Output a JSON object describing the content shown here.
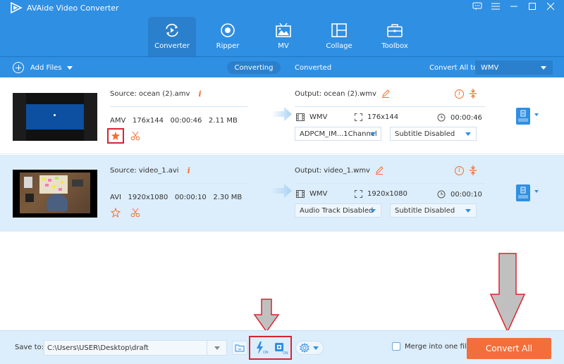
{
  "app": {
    "title": "AVAide Video Converter",
    "window_controls": [
      "feedback-icon",
      "menu-icon",
      "minimize-icon",
      "maximize-icon",
      "close-icon"
    ]
  },
  "nav": {
    "items": [
      {
        "label": "Converter",
        "icon": "converter-icon",
        "active": true
      },
      {
        "label": "Ripper",
        "icon": "ripper-icon",
        "active": false
      },
      {
        "label": "MV",
        "icon": "mv-icon",
        "active": false
      },
      {
        "label": "Collage",
        "icon": "collage-icon",
        "active": false
      },
      {
        "label": "Toolbox",
        "icon": "toolbox-icon",
        "active": false
      }
    ]
  },
  "toolbar": {
    "add_files_label": "Add Files",
    "tab_converting": "Converting",
    "tab_converted": "Converted",
    "convert_all_to_label": "Convert All to:",
    "convert_all_to_value": "WMV"
  },
  "files": [
    {
      "source": "Source: ocean (2).amv",
      "meta": "AMV   176x144   00:00:46   2.11 MB",
      "output": "Output: ocean (2).wmv",
      "format": "WMV",
      "resolution": "176x144",
      "duration": "00:00:46",
      "audio_track": "ADPCM_IM...1Channel",
      "subtitle": "Subtitle Disabled",
      "enhance_highlighted": true
    },
    {
      "source": "Source: video_1.avi",
      "meta": "AVI   1920x1080   00:00:10   2.30 MB",
      "output": "Output: video_1.wmv",
      "format": "WMV",
      "resolution": "1920x1080",
      "duration": "00:00:10",
      "audio_track": "Audio Track Disabled",
      "subtitle": "Subtitle Disabled",
      "enhance_highlighted": false
    }
  ],
  "footer": {
    "save_to_label": "Save to:",
    "save_path": "C:\\Users\\USER\\Desktop\\draft",
    "hw_accel_badge": "ON",
    "gpu_accel_badge": "ON",
    "merge_label": "Merge into one file",
    "merge_checked": false,
    "convert_all_label": "Convert All"
  },
  "colors": {
    "brand_blue": "#2f8fe3",
    "accent_orange": "#f26f3b",
    "highlight_red": "#d9232f",
    "annotation_arrow_fill": "#c0c0c0"
  }
}
